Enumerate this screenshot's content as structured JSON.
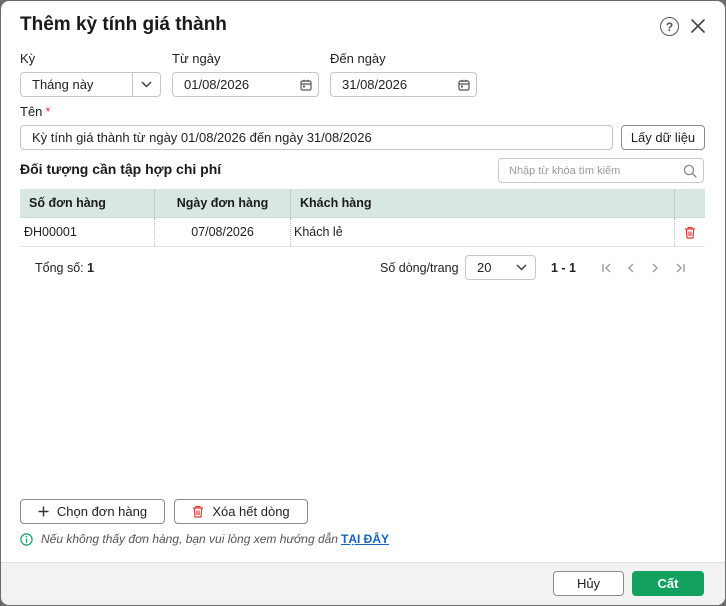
{
  "dialog": {
    "title": "Thêm kỳ tính giá thành",
    "help_icon": "question-circle-icon",
    "close_icon": "close-icon"
  },
  "form": {
    "period_label": "Kỳ",
    "period_value": "Tháng này",
    "from_label": "Từ ngày",
    "from_value": "01/08/2026",
    "to_label": "Đến ngày",
    "to_value": "31/08/2026",
    "name_label": "Tên",
    "required_mark": "*",
    "name_value": "Kỳ tính giá thành từ ngày 01/08/2026 đến ngày 31/08/2026",
    "fetch_button": "Lấy dữ liệu"
  },
  "section": {
    "title": "Đối tượng cần tập hợp chi phí",
    "search_placeholder": "Nhập từ khóa tìm kiếm"
  },
  "grid": {
    "columns": [
      "Số đơn hàng",
      "Ngày đơn hàng",
      "Khách hàng"
    ],
    "rows": [
      {
        "order_no": "ĐH00001",
        "order_date": "07/08/2026",
        "customer": "Khách lẻ"
      }
    ]
  },
  "pagination": {
    "total_label": "Tổng số:",
    "total_value": "1",
    "rows_per_page_label": "Số dòng/trang",
    "rows_per_page_value": "20",
    "range": "1 - 1"
  },
  "actions": {
    "choose_orders": "Chọn đơn hàng",
    "clear_rows": "Xóa hết dòng"
  },
  "hint": {
    "text": "Nếu không thấy đơn hàng, bạn vui lòng xem hướng dẫn",
    "link": "TẠI ĐÂY"
  },
  "footer": {
    "cancel": "Hủy",
    "save": "Cất"
  },
  "colors": {
    "primary": "#13a160",
    "grid_header": "#d8e8e0",
    "delete": "#e53935",
    "link": "#1565c0",
    "hint_icon": "#13a160"
  }
}
